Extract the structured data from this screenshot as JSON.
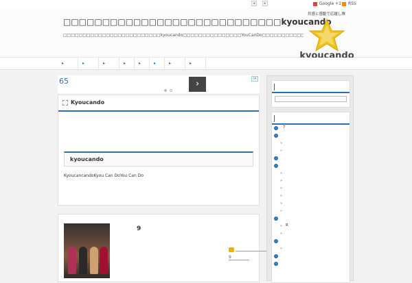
{
  "topbar": {
    "nav_prev": "◂",
    "nav_next": "▸",
    "tagline": "共感と感動で応援し隊",
    "google": "Google +1",
    "rss": "RSS"
  },
  "header": {
    "title": "□□□□□□□□□□□□□□□□□□□□□□□□□□□□kyoucando",
    "description": "□□□□□□□□□□□□□□□□□□□□□□□□□kyoucando□□□□□□□□□□□□□□□YouCanDo□□□□□□□□□□□□□□□□□□□□□□□□□□□□□□□□□□□□□□□□□□□□□□□□□□□□□□□□",
    "logo_text": "kyoucando",
    "brand_color": "#f0c419"
  },
  "nav": {
    "items": [
      "▸",
      "▸",
      "▸",
      "▸",
      "▸",
      "▸",
      "▸",
      "▸"
    ]
  },
  "ad": {
    "number": "65",
    "badge": "i✕",
    "arrow": "›"
  },
  "widget": {
    "title": "Kyoucando",
    "inner_title": "kyoucando",
    "text": "KyoucancandoKyou Can DoYou Can Do"
  },
  "post": {
    "title": "9",
    "link": "9"
  },
  "sidebar": {
    "list": [
      {
        "type": "bullet",
        "text": "7"
      },
      {
        "type": "bullet",
        "text": ""
      },
      {
        "type": "sub",
        "text": ""
      },
      {
        "type": "sub",
        "text": ""
      },
      {
        "type": "bullet",
        "text": ""
      },
      {
        "type": "bullet",
        "text": ""
      },
      {
        "type": "sub",
        "text": ""
      },
      {
        "type": "sub",
        "text": ""
      },
      {
        "type": "sub",
        "text": ""
      },
      {
        "type": "sub",
        "text": ""
      },
      {
        "type": "sub",
        "text": ""
      },
      {
        "type": "sub",
        "text": ""
      },
      {
        "type": "bullet",
        "text": ""
      },
      {
        "type": "sub",
        "text": "R"
      },
      {
        "type": "sub",
        "text": ""
      },
      {
        "type": "bullet",
        "text": ""
      },
      {
        "type": "sub",
        "text": ""
      },
      {
        "type": "bullet",
        "text": ""
      },
      {
        "type": "bullet",
        "text": ""
      }
    ],
    "sub_marker": "»"
  },
  "colors": {
    "accent": "#2a6fb0",
    "background": "#f2f2f2"
  }
}
